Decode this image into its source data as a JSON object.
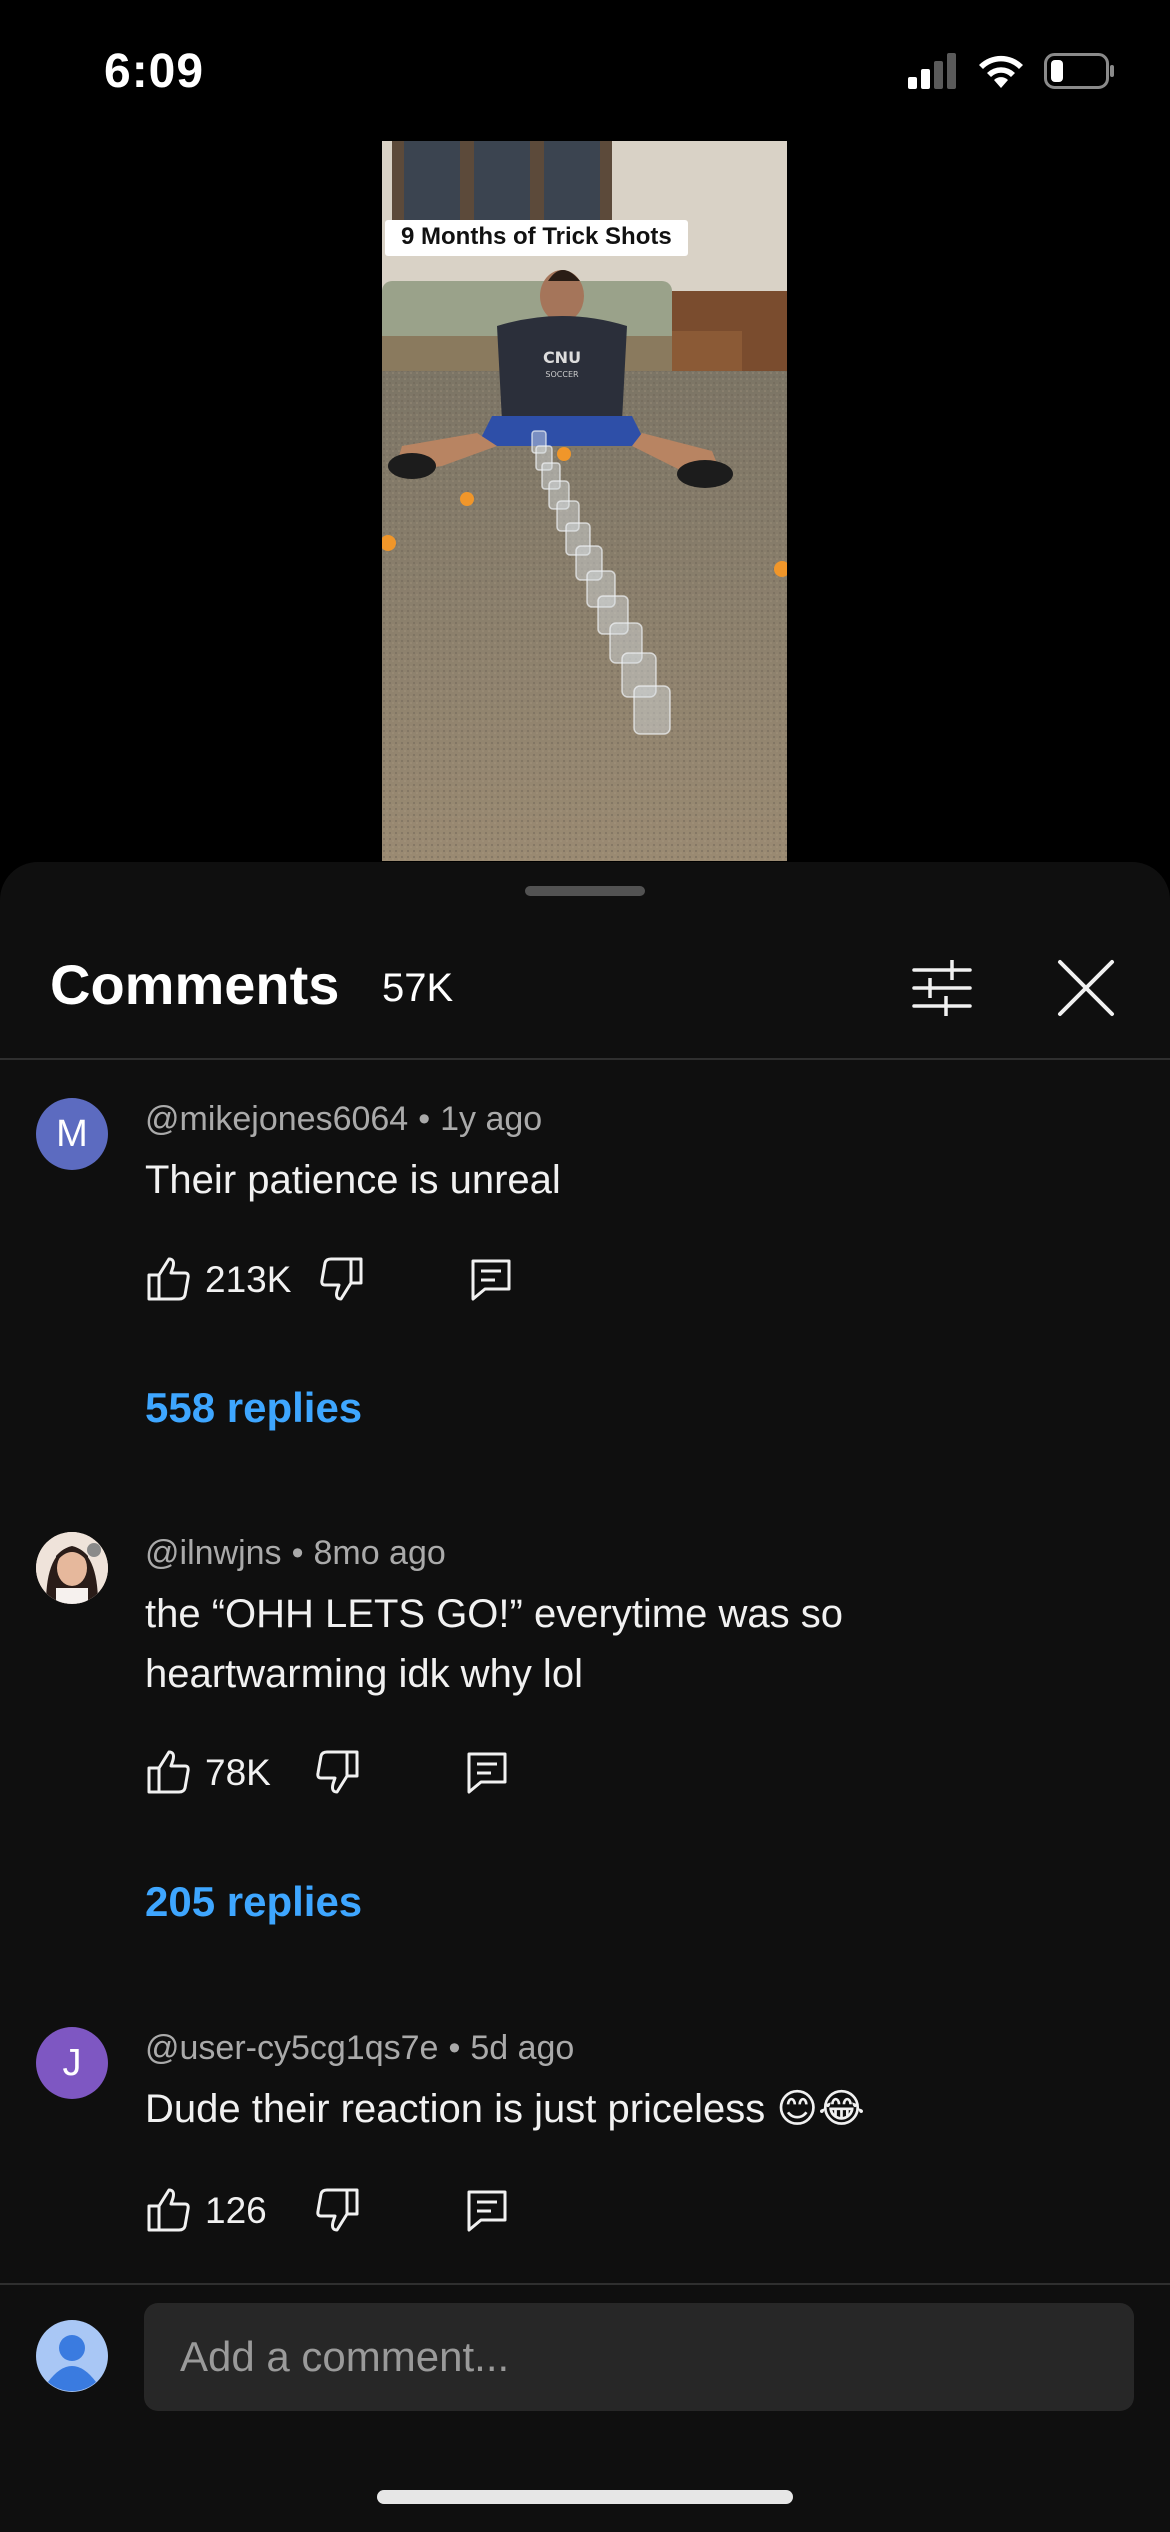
{
  "status_bar": {
    "time": "6:09",
    "icons": [
      "cellular-signal-icon",
      "wifi-icon",
      "battery-icon"
    ]
  },
  "video": {
    "caption": "9 Months of Trick Shots",
    "shirt_text": "CNU SOCCER"
  },
  "comments_panel": {
    "title": "Comments",
    "count": "57K",
    "icons": [
      "filter-sliders-icon",
      "close-icon"
    ]
  },
  "comments": [
    {
      "avatar_letter": "M",
      "avatar_color": "#5c6bc0",
      "author": "@mikejones6064",
      "time": "1y ago",
      "text": "Their patience is unreal",
      "likes": "213K",
      "replies": "558 replies"
    },
    {
      "avatar_letter": "",
      "avatar_color": "#e8d4c8",
      "author": "@ilnwjns",
      "time": "8mo ago",
      "text_lines": [
        "the “OHH LETS GO!” everytime was so",
        "heartwarming idk why lol"
      ],
      "likes": "78K",
      "replies": "205 replies"
    },
    {
      "avatar_letter": "J",
      "avatar_color": "#7e57c2",
      "author": "@user-cy5cg1qs7e",
      "time": "5d ago",
      "text": "Dude their reaction is just priceless 😊😂",
      "likes": "126"
    }
  ],
  "input": {
    "placeholder": "Add a comment..."
  },
  "colors": {
    "accent_link": "#3ea6ff",
    "sheet_bg": "#0f0f0f",
    "input_bg": "#272727"
  }
}
